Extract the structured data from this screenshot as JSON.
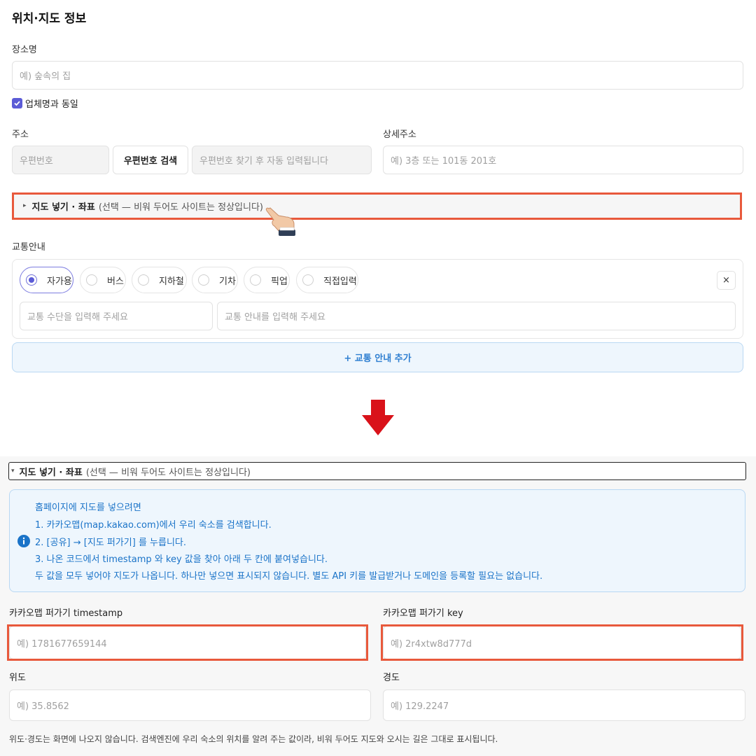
{
  "top": {
    "section_title": "위치·지도 정보",
    "place_label": "장소명",
    "place_placeholder": "예) 숲속의 집",
    "same_as_company_label": "업체명과 동일",
    "address_label": "주소",
    "detail_address_label": "상세주소",
    "postcode_placeholder": "우편번호",
    "postcode_search_label": "우편번호 검색",
    "address_auto_placeholder": "우편번호 찾기 후 자동 입력됩니다",
    "detail_placeholder": "예) 3층 또는 101동 201호",
    "map_toggle_title": "지도 넣기 · 좌표",
    "map_toggle_note": "(선택 — 비워 두어도 사이트는 정상입니다)",
    "transport_label": "교통안내",
    "transport_options": [
      "자가용",
      "버스",
      "지하철",
      "기차",
      "픽업",
      "직접입력"
    ],
    "selected_option": "자가용",
    "remove_label": "×",
    "transport_means_placeholder": "교통 수단을 입력해 주세요",
    "transport_info_placeholder": "교통 안내를 입력해 주세요",
    "add_transport_label": "+ 교통 안내 추가"
  },
  "bottom": {
    "map_toggle_title": "지도 넣기 · 좌표",
    "map_toggle_note": "(선택 — 비워 두어도 사이트는 정상입니다)",
    "info_lines": [
      "홈페이지에 지도를 넣으려면",
      "1. 카카오맵(map.kakao.com)에서 우리 숙소를 검색합니다.",
      "2. [공유] → [지도 퍼가기] 를 누릅니다.",
      "3. 나온 코드에서 timestamp 와 key 값을 찾아 아래 두 칸에 붙여넣습니다.",
      "두 값을 모두 넣어야 지도가 나옵니다. 하나만 넣으면 표시되지 않습니다. 별도 API 키를 발급받거나 도메인을 등록할 필요는 없습니다."
    ],
    "timestamp_label": "카카오맵 퍼가기 timestamp",
    "timestamp_placeholder": "예) 1781677659144",
    "key_label": "카카오맵 퍼가기 key",
    "key_placeholder": "예) 2r4xtw8d777d",
    "lat_label": "위도",
    "lat_placeholder": "예) 35.8562",
    "lng_label": "경도",
    "lng_placeholder": "예) 129.2247",
    "footnote": "위도·경도는 화면에 나오지 않습니다. 검색엔진에 우리 숙소의 위치를 알려 주는 값이라, 비워 두어도 지도와 오시는 길은 그대로 표시됩니다."
  },
  "colors": {
    "highlight": "#e8593c",
    "arrow": "#d9121a",
    "accent": "#5b5bd6",
    "info_text": "#1a73c8",
    "info_bg": "#eef6fd"
  }
}
